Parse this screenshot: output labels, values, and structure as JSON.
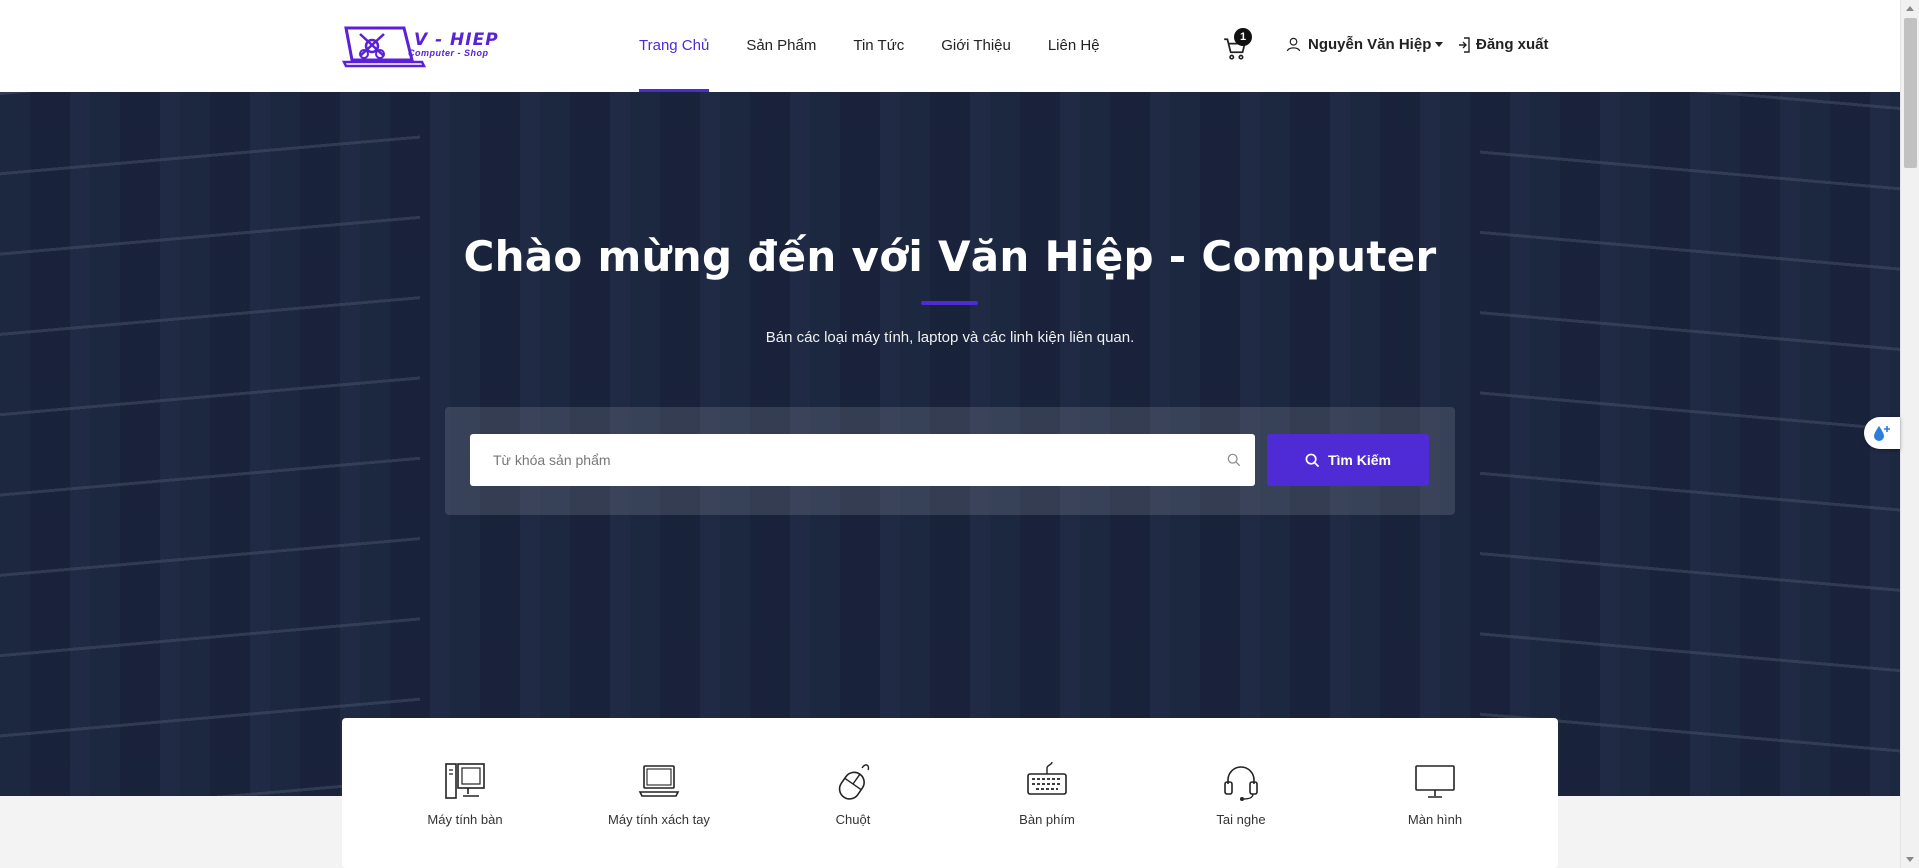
{
  "header": {
    "logo": {
      "name": "V - HIEP",
      "sub": "Computer - Shop"
    },
    "nav": [
      {
        "label": "Trang Chủ",
        "active": true
      },
      {
        "label": "Sản Phẩm",
        "active": false
      },
      {
        "label": "Tin Tức",
        "active": false
      },
      {
        "label": "Giới Thiệu",
        "active": false
      },
      {
        "label": "Liên Hệ",
        "active": false
      }
    ],
    "cart": {
      "icon": "cart-icon",
      "count": "1"
    },
    "user": {
      "name": "Nguyễn Văn Hiệp",
      "icon": "user-icon"
    },
    "logout": {
      "label": "Đăng xuất",
      "icon": "logout-icon"
    }
  },
  "hero": {
    "title": "Chào mừng đến với Văn Hiệp - Computer",
    "subtitle": "Bán các loại máy tính, laptop và các linh kiện liên quan.",
    "search": {
      "placeholder": "Từ khóa sản phẩm",
      "value": "",
      "button_label": "Tìm Kiếm"
    }
  },
  "categories": [
    {
      "label": "Máy tính bàn",
      "icon": "desktop-computer-icon"
    },
    {
      "label": "Máy tính xách tay",
      "icon": "laptop-icon"
    },
    {
      "label": "Chuột",
      "icon": "mouse-icon"
    },
    {
      "label": "Bàn phím",
      "icon": "keyboard-icon"
    },
    {
      "label": "Tai nghe",
      "icon": "headphones-icon"
    },
    {
      "label": "Màn hình",
      "icon": "monitor-icon"
    }
  ],
  "colors": {
    "accent": "#4f2bd6",
    "hero_overlay": "#1e2a44",
    "header_bg": "#ffffff"
  }
}
